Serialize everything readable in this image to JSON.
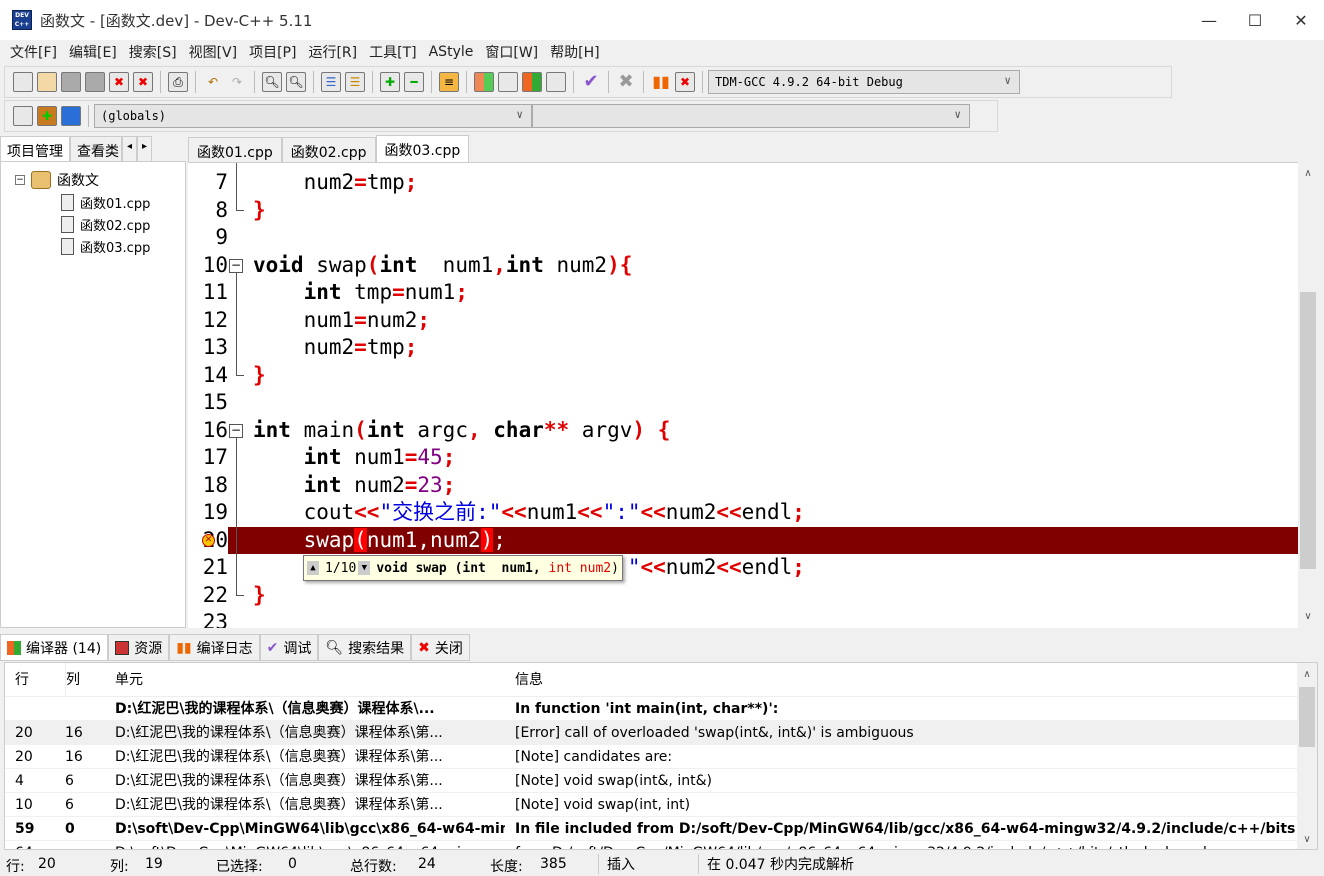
{
  "window": {
    "title": "函数文 - [函数文.dev] - Dev-C++ 5.11",
    "app_icon_text": "DEV C++"
  },
  "menu": [
    "文件[F]",
    "编辑[E]",
    "搜索[S]",
    "视图[V]",
    "项目[P]",
    "运行[R]",
    "工具[T]",
    "AStyle",
    "窗口[W]",
    "帮助[H]"
  ],
  "toolbar": {
    "compiler": "TDM-GCC 4.9.2 64-bit Debug",
    "scope": "(globals)",
    "member": ""
  },
  "left_tabs": [
    "项目管理",
    "查看类"
  ],
  "project": {
    "name": "函数文",
    "files": [
      "函数01.cpp",
      "函数02.cpp",
      "函数03.cpp"
    ]
  },
  "file_tabs": [
    "函数01.cpp",
    "函数02.cpp",
    "函数03.cpp"
  ],
  "active_file_tab": 2,
  "editor": {
    "lines": [
      {
        "n": "7",
        "tokens": [
          {
            "t": "    num2",
            "c": ""
          },
          {
            "t": "=",
            "c": "op"
          },
          {
            "t": "tmp",
            "c": ""
          },
          {
            "t": ";",
            "c": "op"
          }
        ]
      },
      {
        "n": "8",
        "tokens": [
          {
            "t": "}",
            "c": "op"
          }
        ]
      },
      {
        "n": "9",
        "tokens": []
      },
      {
        "n": "10",
        "tokens": [
          {
            "t": "void",
            "c": "kw"
          },
          {
            "t": " swap",
            "c": ""
          },
          {
            "t": "(",
            "c": "op"
          },
          {
            "t": "int",
            "c": "kw"
          },
          {
            "t": "  num1",
            "c": ""
          },
          {
            "t": ",",
            "c": "op"
          },
          {
            "t": "int",
            "c": "kw"
          },
          {
            "t": " num2",
            "c": ""
          },
          {
            "t": "){",
            "c": "op"
          }
        ]
      },
      {
        "n": "11",
        "tokens": [
          {
            "t": "    ",
            "c": ""
          },
          {
            "t": "int",
            "c": "kw"
          },
          {
            "t": " tmp",
            "c": ""
          },
          {
            "t": "=",
            "c": "op"
          },
          {
            "t": "num1",
            "c": ""
          },
          {
            "t": ";",
            "c": "op"
          }
        ]
      },
      {
        "n": "12",
        "tokens": [
          {
            "t": "    num1",
            "c": ""
          },
          {
            "t": "=",
            "c": "op"
          },
          {
            "t": "num2",
            "c": ""
          },
          {
            "t": ";",
            "c": "op"
          }
        ]
      },
      {
        "n": "13",
        "tokens": [
          {
            "t": "    num2",
            "c": ""
          },
          {
            "t": "=",
            "c": "op"
          },
          {
            "t": "tmp",
            "c": ""
          },
          {
            "t": ";",
            "c": "op"
          }
        ]
      },
      {
        "n": "14",
        "tokens": [
          {
            "t": "}",
            "c": "op"
          }
        ]
      },
      {
        "n": "15",
        "tokens": []
      },
      {
        "n": "16",
        "tokens": [
          {
            "t": "int",
            "c": "kw"
          },
          {
            "t": " main",
            "c": ""
          },
          {
            "t": "(",
            "c": "op"
          },
          {
            "t": "int",
            "c": "kw"
          },
          {
            "t": " argc",
            "c": ""
          },
          {
            "t": ",",
            "c": "op"
          },
          {
            "t": " ",
            "c": ""
          },
          {
            "t": "char",
            "c": "kw"
          },
          {
            "t": "**",
            "c": "op"
          },
          {
            "t": " argv",
            "c": ""
          },
          {
            "t": ")",
            "c": "op"
          },
          {
            "t": " ",
            "c": ""
          },
          {
            "t": "{",
            "c": "op"
          }
        ]
      },
      {
        "n": "17",
        "tokens": [
          {
            "t": "    ",
            "c": ""
          },
          {
            "t": "int",
            "c": "kw"
          },
          {
            "t": " num1",
            "c": ""
          },
          {
            "t": "=",
            "c": "op"
          },
          {
            "t": "45",
            "c": "num"
          },
          {
            "t": ";",
            "c": "op"
          }
        ]
      },
      {
        "n": "18",
        "tokens": [
          {
            "t": "    ",
            "c": ""
          },
          {
            "t": "int",
            "c": "kw"
          },
          {
            "t": " num2",
            "c": ""
          },
          {
            "t": "=",
            "c": "op"
          },
          {
            "t": "23",
            "c": "num"
          },
          {
            "t": ";",
            "c": "op"
          }
        ]
      },
      {
        "n": "19",
        "tokens": [
          {
            "t": "    cout",
            "c": ""
          },
          {
            "t": "<<",
            "c": "op"
          },
          {
            "t": "\"交换之前:\"",
            "c": "str"
          },
          {
            "t": "<<",
            "c": "op"
          },
          {
            "t": "num1",
            "c": ""
          },
          {
            "t": "<<",
            "c": "op"
          },
          {
            "t": "\":\"",
            "c": "str"
          },
          {
            "t": "<<",
            "c": "op"
          },
          {
            "t": "num2",
            "c": ""
          },
          {
            "t": "<<",
            "c": "op"
          },
          {
            "t": "endl",
            "c": ""
          },
          {
            "t": ";",
            "c": "op"
          }
        ]
      },
      {
        "n": "20",
        "hl": true,
        "tokens": [
          {
            "t": "    swap",
            "c": ""
          },
          {
            "t": "(",
            "c": "op"
          },
          {
            "t": "num1,num2",
            "c": ""
          },
          {
            "t": ")",
            "c": "op"
          },
          {
            "t": ";",
            "c": ""
          }
        ]
      },
      {
        "n": "21",
        "tokens": [
          {
            "t": "    cout",
            "c": ""
          },
          {
            "t": "<<",
            "c": "op"
          },
          {
            "t": "\"交换之后:\"",
            "c": "str"
          },
          {
            "t": "<<",
            "c": "op"
          },
          {
            "t": "num1",
            "c": ""
          },
          {
            "t": "<<",
            "c": "op"
          },
          {
            "t": "\":\"",
            "c": "str"
          },
          {
            "t": "<<",
            "c": "op"
          },
          {
            "t": "num2",
            "c": ""
          },
          {
            "t": "<<",
            "c": "op"
          },
          {
            "t": "endl",
            "c": ""
          },
          {
            "t": ";",
            "c": "op"
          }
        ]
      },
      {
        "n": "22",
        "tokens": [
          {
            "t": "}",
            "c": "op"
          }
        ]
      },
      {
        "n": "23",
        "tokens": []
      }
    ],
    "tooltip": {
      "counter": "1/10",
      "prefix": "void swap (int  num1, ",
      "current": "int num2",
      "suffix": ")"
    }
  },
  "bottom_tabs": [
    "编译器 (14)",
    "资源",
    "编译日志",
    "调试",
    "搜索结果",
    "关闭"
  ],
  "messages": {
    "headers": [
      "行",
      "列",
      "单元",
      "信息"
    ],
    "rows": [
      {
        "line": "",
        "col": "",
        "unit": "D:\\红泥巴\\我的课程体系\\（信息奥赛）课程体系\\...",
        "msg": "In function 'int main(int, char**)':",
        "bold": true
      },
      {
        "line": "20",
        "col": "16",
        "unit": "D:\\红泥巴\\我的课程体系\\（信息奥赛）课程体系\\第...",
        "msg": "[Error] call of overloaded 'swap(int&, int&)' is ambiguous",
        "sel": true
      },
      {
        "line": "20",
        "col": "16",
        "unit": "D:\\红泥巴\\我的课程体系\\（信息奥赛）课程体系\\第...",
        "msg": "[Note] candidates are:"
      },
      {
        "line": "4",
        "col": "6",
        "unit": "D:\\红泥巴\\我的课程体系\\（信息奥赛）课程体系\\第...",
        "msg": "[Note] void swap(int&, int&)"
      },
      {
        "line": "10",
        "col": "6",
        "unit": "D:\\红泥巴\\我的课程体系\\（信息奥赛）课程体系\\第...",
        "msg": "[Note] void swap(int, int)"
      },
      {
        "line": "59",
        "col": "0",
        "unit": "D:\\soft\\Dev-Cpp\\MinGW64\\lib\\gcc\\x86_64-w64-min...",
        "msg": "In file included from D:/soft/Dev-Cpp/MinGW64/lib/gcc/x86_64-w64-mingw32/4.9.2/include/c++/bits/stl_pai...",
        "bold": true
      },
      {
        "line": "64",
        "col": "",
        "unit": "D:\\soft\\Dev-Cpp\\MinGW64\\lib\\gcc\\x86_64-w64-min...",
        "msg": "                 from D:/soft/Dev-Cpp/MinGW64/lib/gcc/x86_64-w64-mingw32/4.9.2/include/c++/bits/stl_algobase.h"
      }
    ]
  },
  "status": {
    "row_label": "行:",
    "row": "20",
    "col_label": "列:",
    "col": "19",
    "sel_label": "已选择:",
    "sel": "0",
    "total_label": "总行数:",
    "total": "24",
    "len_label": "长度:",
    "len": "385",
    "mode": "插入",
    "parse": "在 0.047 秒内完成解析"
  },
  "colors": {
    "highlight_line": "#800000",
    "operator": "#e00000",
    "number": "#800080",
    "string": "#0000e0"
  }
}
